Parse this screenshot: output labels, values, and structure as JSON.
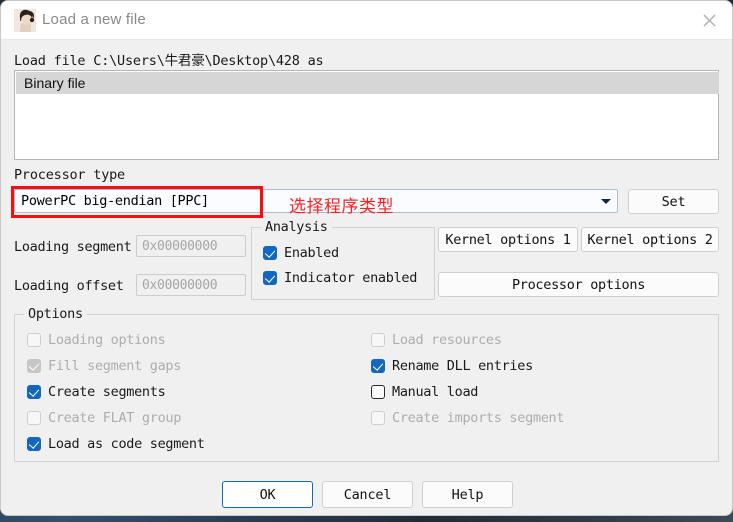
{
  "window": {
    "title": "Load a new file",
    "icon": "ida-logo-icon",
    "close_icon": "close-icon"
  },
  "file": {
    "label": "Load file C:\\Users\\牛君豪\\Desktop\\428 as",
    "loader_items": [
      "Binary file"
    ],
    "selected_loader": "Binary file"
  },
  "processor": {
    "label": "Processor type",
    "selected": "PowerPC big-endian [PPC]",
    "dropdown_icon": "chevron-down-icon",
    "set_button": "Set"
  },
  "annotation": {
    "text": "选择程序类型",
    "color": "#fc2020",
    "box_color": "#fc0d0d"
  },
  "loading": {
    "segment_label": "Loading segment",
    "segment_value": "0x00000000",
    "offset_label": "Loading offset",
    "offset_value": "0x00000000"
  },
  "analysis": {
    "title": "Analysis",
    "items": [
      {
        "label": "Enabled",
        "checked": true,
        "enabled": true
      },
      {
        "label": "Indicator enabled",
        "checked": true,
        "enabled": true
      }
    ]
  },
  "side_buttons": {
    "kernel_options_1": "Kernel options 1",
    "kernel_options_2": "Kernel options 2",
    "processor_options": "Processor options"
  },
  "options": {
    "title": "Options",
    "left_column": [
      {
        "label": "Loading options",
        "checked": false,
        "enabled": false
      },
      {
        "label": "Fill segment gaps",
        "checked": true,
        "enabled": false
      },
      {
        "label": "Create segments",
        "checked": true,
        "enabled": true
      },
      {
        "label": "Create FLAT group",
        "checked": false,
        "enabled": false
      },
      {
        "label": "Load as code segment",
        "checked": true,
        "enabled": true
      }
    ],
    "right_column": [
      {
        "label": "Load resources",
        "checked": false,
        "enabled": false
      },
      {
        "label": "Rename DLL entries",
        "checked": true,
        "enabled": true
      },
      {
        "label": "Manual load",
        "checked": false,
        "enabled": true
      },
      {
        "label": "Create imports segment",
        "checked": false,
        "enabled": false
      }
    ]
  },
  "footer": {
    "ok": "OK",
    "cancel": "Cancel",
    "help": "Help"
  },
  "colors": {
    "accent": "#1268c0",
    "dialog_bg": "#f0f0f0",
    "titlebar_bg": "#ffffff"
  }
}
